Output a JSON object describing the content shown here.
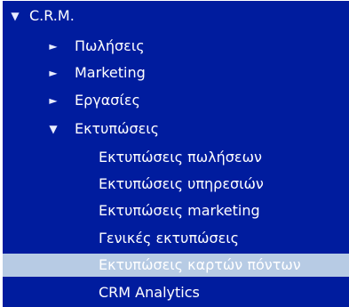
{
  "tree": {
    "root": {
      "label": "C.R.M.",
      "toggle_icon": "chevron-down-icon",
      "toggle_glyph": "▼",
      "expanded": true
    },
    "groups": [
      {
        "label": "Πωλήσεις",
        "toggle_icon": "chevron-right-icon",
        "toggle_glyph": "►",
        "expanded": false
      },
      {
        "label": "Marketing",
        "toggle_icon": "chevron-right-icon",
        "toggle_glyph": "►",
        "expanded": false
      },
      {
        "label": "Εργασίες",
        "toggle_icon": "chevron-right-icon",
        "toggle_glyph": "►",
        "expanded": false
      },
      {
        "label": "Εκτυπώσεις",
        "toggle_icon": "chevron-down-icon",
        "toggle_glyph": "▼",
        "expanded": true
      }
    ],
    "print_items": [
      {
        "label": "Εκτυπώσεις πωλήσεων",
        "selected": false
      },
      {
        "label": "Εκτυπώσεις υπηρεσιών",
        "selected": false
      },
      {
        "label": "Εκτυπώσεις marketing",
        "selected": false
      },
      {
        "label": "Γενικές εκτυπώσεις",
        "selected": false
      },
      {
        "label": "Εκτυπώσεις καρτών πόντων",
        "selected": true
      }
    ],
    "crm_analytics": {
      "label": "CRM Analytics"
    }
  },
  "colors": {
    "background": "#001c9e",
    "text": "#ffffff",
    "selected_background": "#b7cbe4"
  }
}
